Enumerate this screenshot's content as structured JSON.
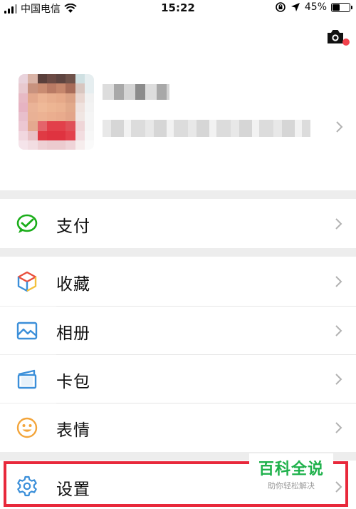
{
  "status_bar": {
    "carrier": "中国电信",
    "time": "15:22",
    "battery": "45%",
    "battery_level": 0.45
  },
  "profile": {
    "camera_icon": "camera-icon"
  },
  "menu": [
    {
      "label": "支付",
      "icon": "payment-icon",
      "color": "#1aad19"
    },
    {
      "label": "收藏",
      "icon": "favorites-cube-icon",
      "color": "#e94e3c"
    },
    {
      "label": "相册",
      "icon": "album-icon",
      "color": "#3b8fd9"
    },
    {
      "label": "卡包",
      "icon": "card-wallet-icon",
      "color": "#3b8fd9"
    },
    {
      "label": "表情",
      "icon": "emoji-smile-icon",
      "color": "#f3a53b"
    },
    {
      "label": "设置",
      "icon": "settings-gear-icon",
      "color": "#3b8fd9"
    }
  ],
  "watermark": {
    "title": "百科全说",
    "subtitle": "助你轻松解决"
  },
  "colors": {
    "highlight": "#e8283b",
    "notification_dot": "#f2434d",
    "watermark_green": "#1fb14b"
  }
}
